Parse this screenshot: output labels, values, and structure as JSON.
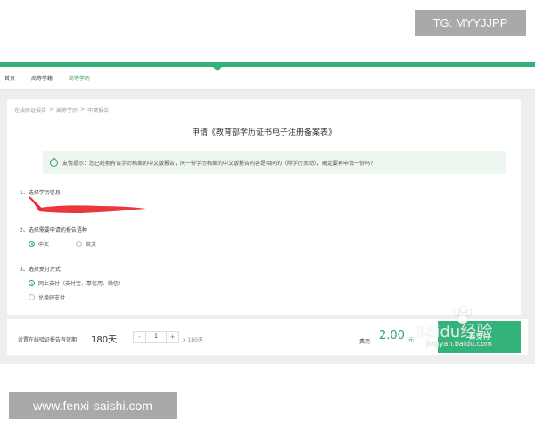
{
  "watermarks": {
    "top": "TG: MYYJJPP",
    "bottom": "www.fenxi-saishi.com"
  },
  "nav": {
    "items": [
      {
        "label": "首页",
        "active": false
      },
      {
        "label": "高等学籍",
        "active": false
      },
      {
        "label": "高等学历",
        "active": true
      }
    ]
  },
  "breadcrumb": [
    "在线验证报告",
    ">",
    "高等学历",
    ">",
    "申请报告"
  ],
  "page_title": "申请《教育部学历证书电子注册备案表》",
  "tip": {
    "label": "友情提示：您已经拥有该学历档案的中文版报告，同一份学历档案的中文版报告内容是相同的（除学历变动），确定要再申请一份吗?"
  },
  "sections": {
    "s1": "1、选择学历信息",
    "s2": "2、选择需要申请的报告语种",
    "s3": "3、选择支付方式"
  },
  "language_options": [
    {
      "label": "中文",
      "checked": true
    },
    {
      "label": "英文",
      "checked": false
    }
  ],
  "payment_options": [
    {
      "label": "网上支付（支付宝、靠信用、微信）",
      "checked": true
    },
    {
      "label": "兑换码支付",
      "checked": false
    }
  ],
  "footer": {
    "validity_label": "设置在线验证报告有效期",
    "validity_value": "180天",
    "stepper_minus": "-",
    "stepper_value": "1",
    "stepper_plus": "+",
    "multiplier": "x 180天",
    "fee_label": "费用",
    "fee_value": "2.00",
    "fee_unit": "元",
    "pay_button": "去支付"
  },
  "baidu_watermark": {
    "text": "Baidu经验",
    "url_text": "jingyan.baidu.com"
  },
  "colors": {
    "accent": "#33b37a",
    "redaction": "#e8262a"
  }
}
